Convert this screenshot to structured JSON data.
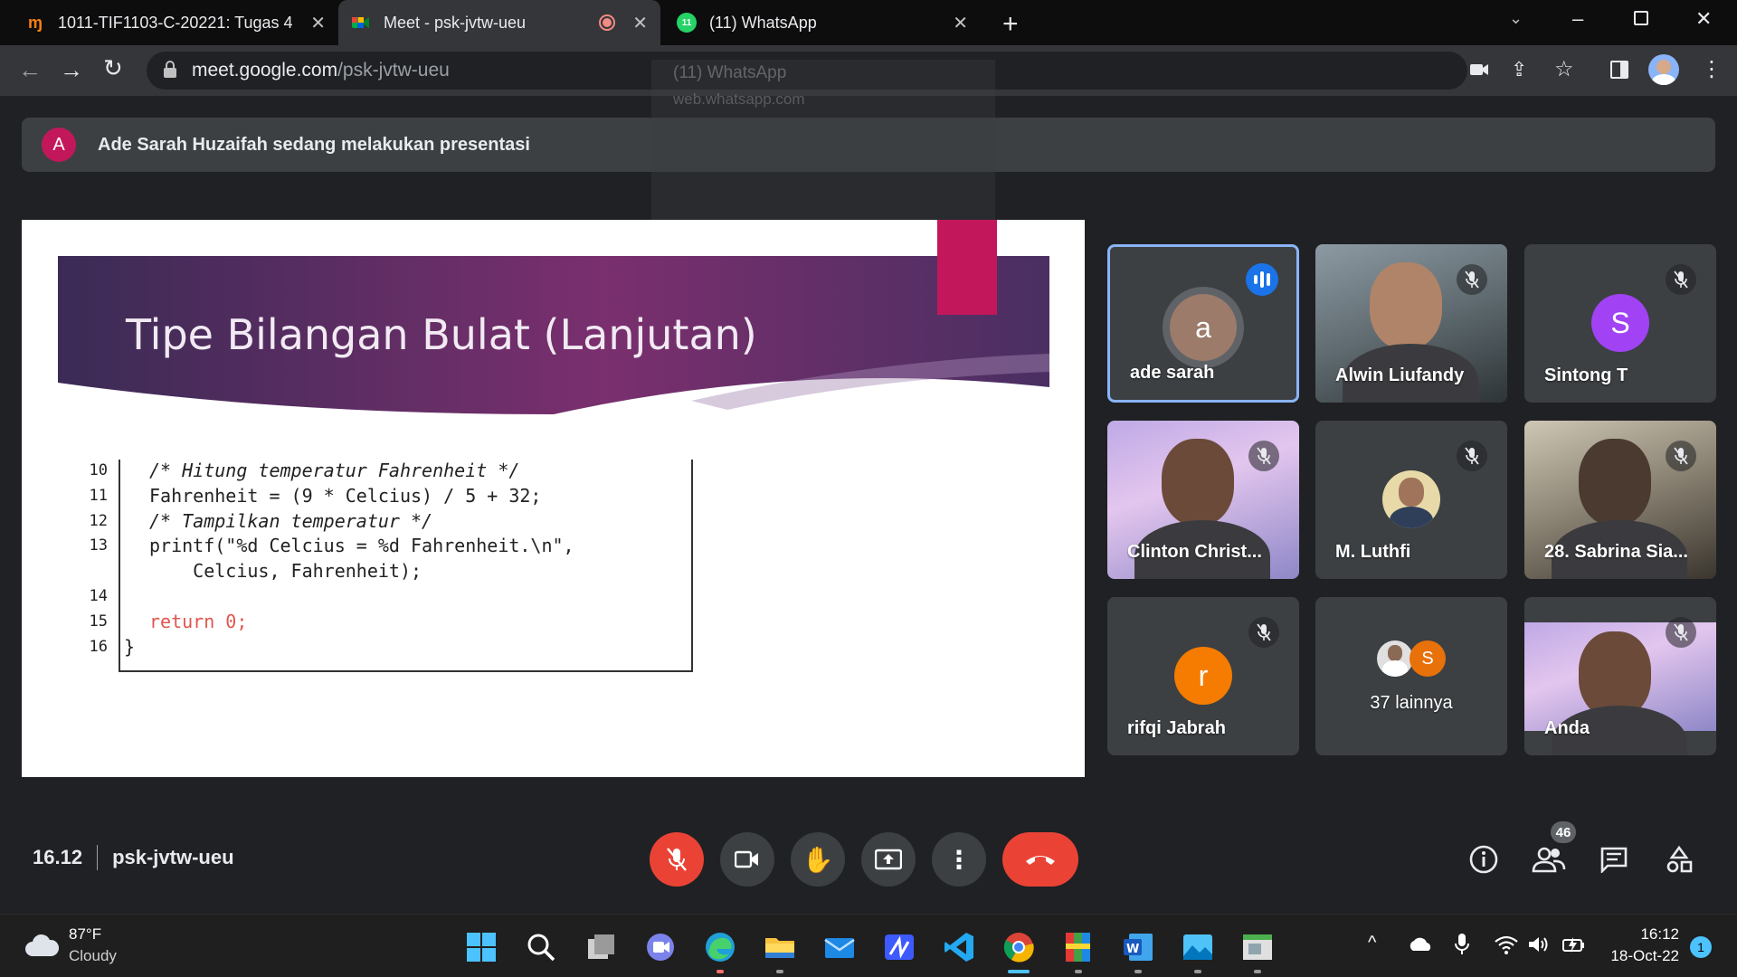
{
  "browser": {
    "tabs": [
      {
        "title": "1011-TIF1103-C-20221: Tugas 4",
        "favicon": "moodle-icon"
      },
      {
        "title": "Meet - psk-jvtw-ueu",
        "favicon": "meet-icon",
        "active": true
      },
      {
        "title": "(11) WhatsApp",
        "favicon": "whatsapp-icon"
      }
    ],
    "url_host": "meet.google.com",
    "url_path": "/psk-jvtw-ueu",
    "tooltip_title": "(11) WhatsApp",
    "tooltip_url": "web.whatsapp.com"
  },
  "meet": {
    "presenter_initial": "A",
    "presenter_banner": "Ade Sarah Huzaifah sedang melakukan presentasi",
    "slide": {
      "title": "Tipe Bilangan Bulat (Lanjutan)",
      "code": [
        {
          "ln": "10",
          "text": "/* Hitung temperatur Fahrenheit */"
        },
        {
          "ln": "11",
          "text": "Fahrenheit = (9 * Celcius) / 5 + 32;"
        },
        {
          "ln": "12",
          "text": "/* Tampilkan temperatur */"
        },
        {
          "ln": "13",
          "text": "printf(\"%d Celcius = %d Fahrenheit.\\n\","
        },
        {
          "ln": "",
          "text": "    Celcius, Fahrenheit);"
        },
        {
          "ln": "14",
          "text": ""
        },
        {
          "ln": "15",
          "text": "return 0;"
        },
        {
          "ln": "16",
          "text": "}"
        }
      ]
    },
    "participants": [
      {
        "name": "ade sarah",
        "initial": "a"
      },
      {
        "name": "Alwin Liufandy"
      },
      {
        "name": "Sintong T",
        "initial": "S"
      },
      {
        "name": "Clinton Christ..."
      },
      {
        "name": "M. Luthfi"
      },
      {
        "name": "28. Sabrina Sia..."
      },
      {
        "name": "rifqi Jabrah",
        "initial": "r"
      },
      {
        "name": "37 lainnya",
        "mini_initial": "S"
      },
      {
        "name": "Anda"
      }
    ],
    "time": "16.12",
    "meeting_code": "psk-jvtw-ueu",
    "people_count": "46"
  },
  "taskbar": {
    "weather_temp": "87°F",
    "weather_desc": "Cloudy",
    "clock_time": "16:12",
    "clock_date": "18-Oct-22",
    "notif_count": "1"
  },
  "colors": {
    "accent_blue": "#8ab4f8",
    "end_call_red": "#ea4335",
    "slide_magenta": "#c2185b"
  }
}
